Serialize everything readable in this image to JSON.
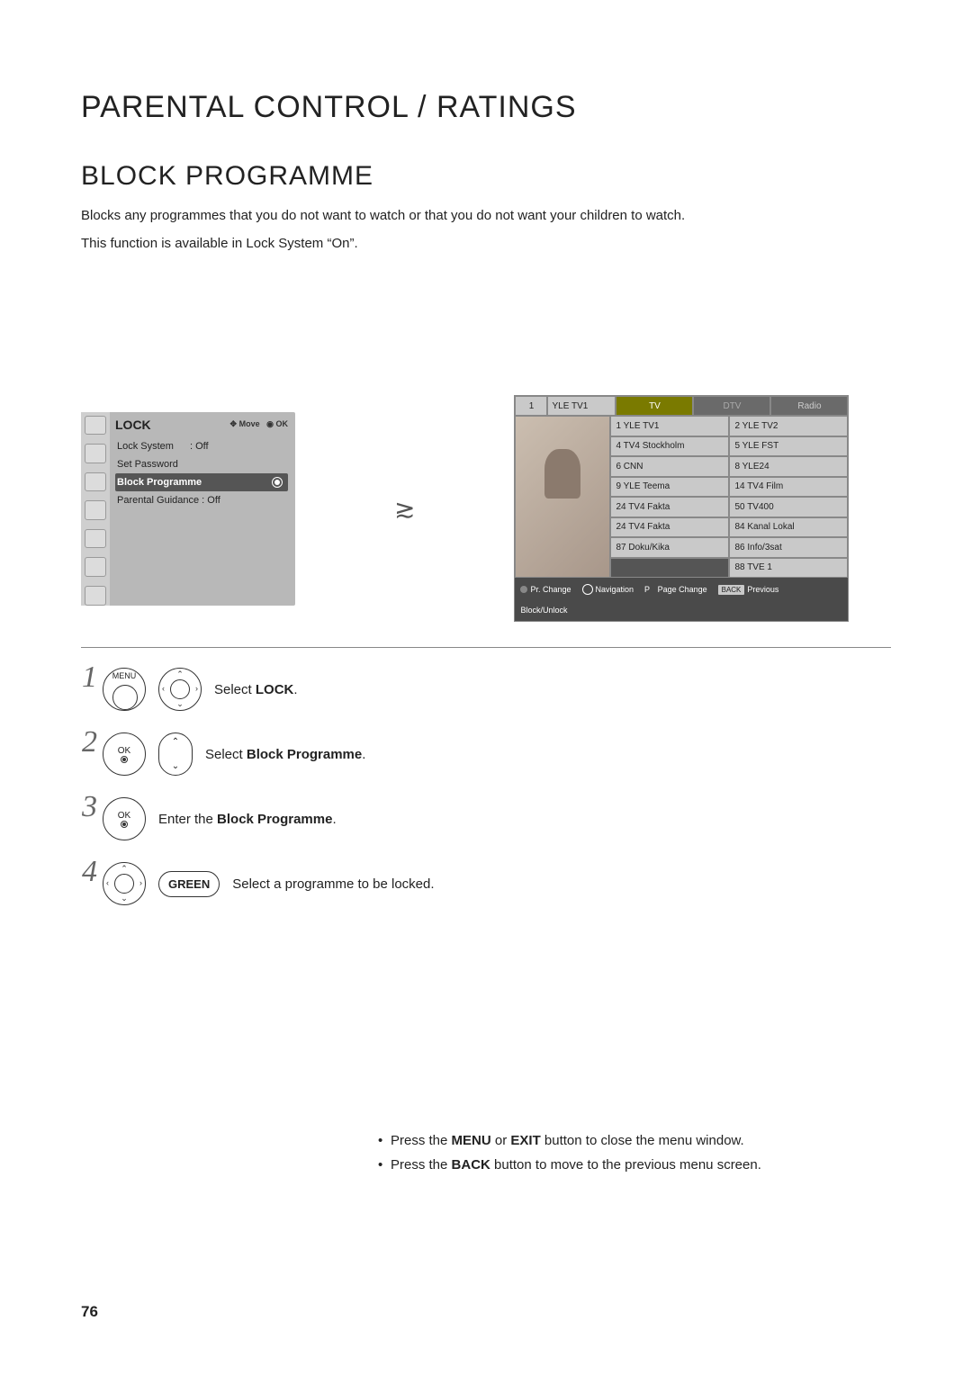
{
  "title": "PARENTAL CONTROL / RATINGS",
  "subtitle": "BLOCK PROGRAMME",
  "intro1": "Blocks any programmes that you do not want to watch or that you do not want your children to watch.",
  "intro2": "This function is available in Lock System “On”.",
  "lockmenu": {
    "title": "LOCK",
    "hint_move": "Move",
    "hint_ok": "OK",
    "rows": {
      "lock_system_label": "Lock System",
      "lock_system_value": ": Off",
      "set_password": "Set Password",
      "block_programme": "Block Programme",
      "parental_guidance": "Parental Guidance : Off"
    }
  },
  "proglist": {
    "ch_num": "1",
    "ch_name": "YLE TV1",
    "tabs": {
      "tv": "TV",
      "dtv": "DTV",
      "radio": "Radio"
    },
    "left_col": [
      "1 YLE TV1",
      "4 TV4 Stockholm",
      "6 CNN",
      "9 YLE Teema",
      "24 TV4 Fakta",
      "24 TV4 Fakta",
      "87 Doku/Kika"
    ],
    "right_col": [
      "2 YLE TV2",
      "5 YLE FST",
      "8 YLE24",
      "14 TV4 Film",
      "50 TV400",
      "84 Kanal Lokal",
      "86 Info/3sat",
      "88 TVE 1"
    ],
    "footer": {
      "pr_change": "Pr. Change",
      "navigation": "Navigation",
      "page_change": "Page Change",
      "back": "BACK",
      "previous": "Previous",
      "block_unlock": "Block/Unlock",
      "p": "P"
    }
  },
  "steps": {
    "s1_btn": "MENU",
    "s1_text_a": "Select ",
    "s1_text_b": "LOCK",
    "s1_text_c": ".",
    "s2_btn": "OK",
    "s2_text_a": "Select ",
    "s2_text_b": "Block Programme",
    "s2_text_c": ".",
    "s3_btn": "OK",
    "s3_text_a": "Enter the ",
    "s3_text_b": "Block Programme",
    "s3_text_c": ".",
    "s4_btn": "GREEN",
    "s4_text": "Select a programme to be locked."
  },
  "notes": {
    "n1a": "Press the ",
    "n1b": "MENU",
    "n1c": " or ",
    "n1d": "EXIT",
    "n1e": " button to close the menu window.",
    "n2a": "Press the ",
    "n2b": "BACK",
    "n2c": " button to move to the previous menu screen."
  },
  "page_number": "76",
  "glyphs": {
    "arrow": "≳",
    "dpad_up": "⌃",
    "dpad_dn": "⌄",
    "dpad_l": "‹",
    "dpad_r": "›",
    "move": "✥",
    "ok": "◉"
  }
}
